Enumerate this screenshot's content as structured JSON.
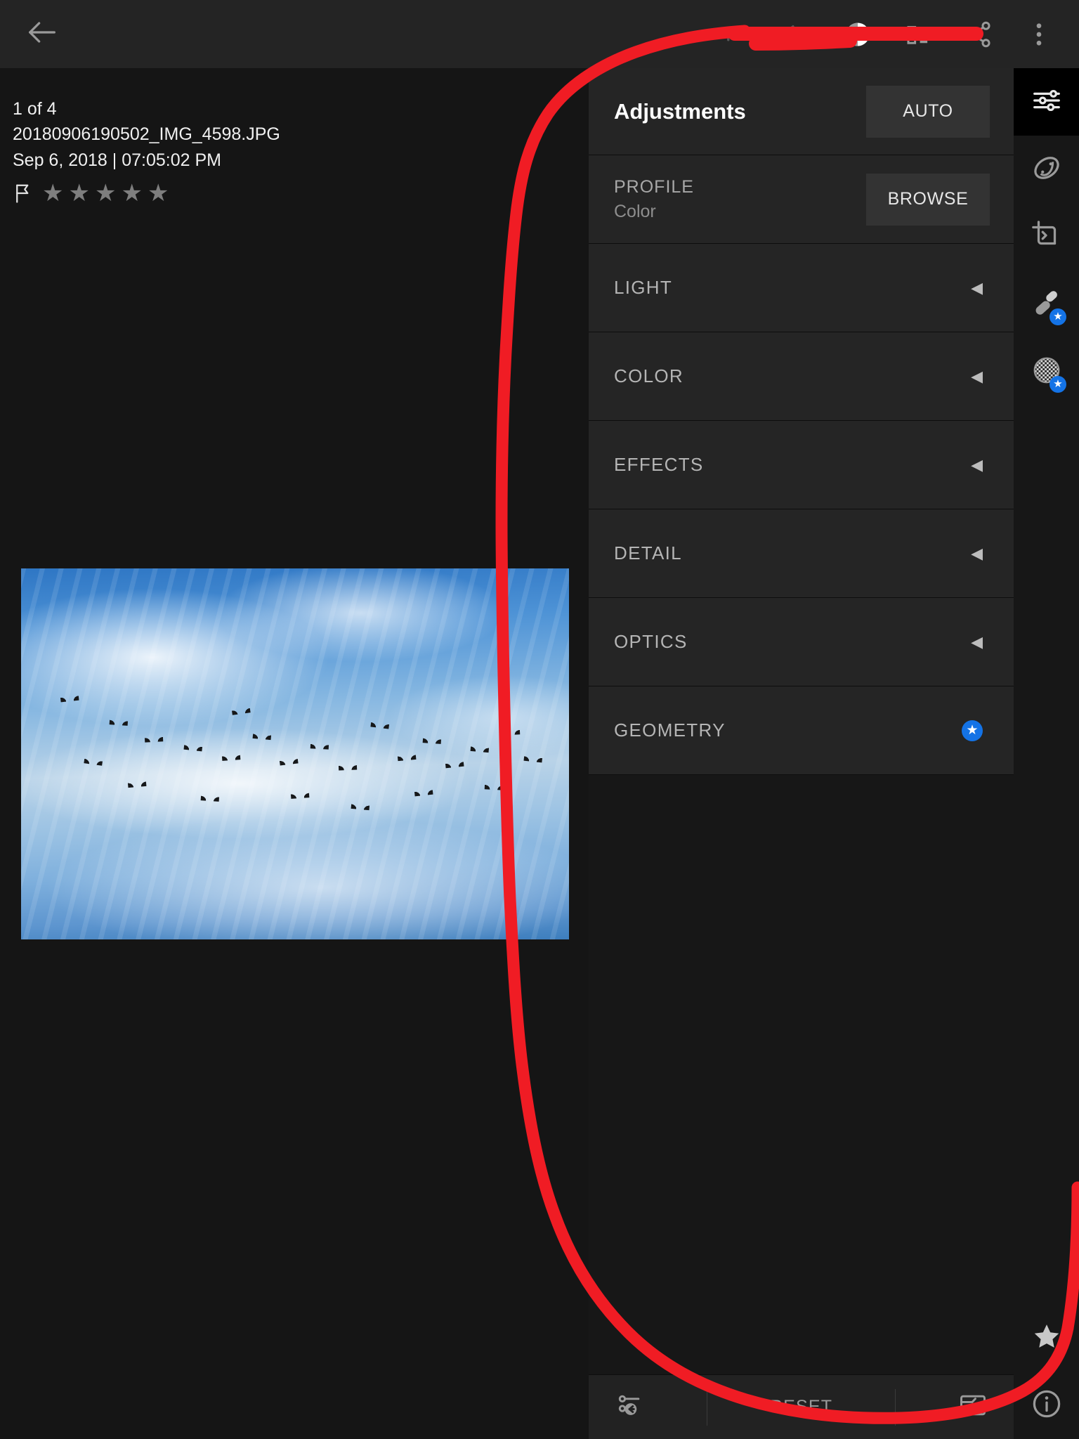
{
  "app": {
    "screen_title": "Adjustments",
    "accent_blue": "#1473e6",
    "annotation_color": "#f01c24",
    "panel_bg": "#252525",
    "app_bg": "#151515"
  },
  "topbar": {
    "back_icon": "arrow-left-icon",
    "redo_icon": "redo-icon",
    "undo_icon": "undo-icon",
    "selective_icon": "selective-edit-icon",
    "histogram_icon": "histogram-icon",
    "share_icon": "share-icon",
    "overflow_icon": "more-vertical-icon"
  },
  "photo_info": {
    "counter": "1 of 4",
    "filename": "20180906190502_IMG_4598.JPG",
    "datetime": "Sep 6, 2018 | 07:05:02 PM",
    "flag_icon": "flag-outline-icon",
    "rating": 0,
    "star_count": 5,
    "star_glyph": "★"
  },
  "panel": {
    "title": "Adjustments",
    "auto_label": "AUTO",
    "profile": {
      "label": "PROFILE",
      "value": "Color",
      "browse_label": "BROWSE"
    },
    "sections": [
      {
        "label": "LIGHT",
        "caret": "◀",
        "badge": false
      },
      {
        "label": "COLOR",
        "caret": "◀",
        "badge": false
      },
      {
        "label": "EFFECTS",
        "caret": "◀",
        "badge": false
      },
      {
        "label": "DETAIL",
        "caret": "◀",
        "badge": false
      },
      {
        "label": "OPTICS",
        "caret": "◀",
        "badge": false
      },
      {
        "label": "GEOMETRY",
        "caret": "",
        "badge": true,
        "badge_glyph": "★"
      }
    ],
    "bottom": {
      "previous_icon": "previous-edits-icon",
      "reset_label": "RESET",
      "versions_icon": "versions-icon"
    }
  },
  "rail": {
    "items": [
      {
        "name": "edit",
        "icon": "sliders-icon",
        "active": true,
        "badge": false
      },
      {
        "name": "healing",
        "icon": "healing-brush-icon",
        "active": false,
        "badge": false
      },
      {
        "name": "crop",
        "icon": "crop-rotate-icon",
        "active": false,
        "badge": false
      },
      {
        "name": "repair",
        "icon": "repair-brush-icon",
        "active": false,
        "badge": true,
        "badge_glyph": "★"
      },
      {
        "name": "masking",
        "icon": "masking-icon",
        "active": false,
        "badge": true,
        "badge_glyph": "★"
      }
    ],
    "bottom_items": [
      {
        "name": "premium",
        "icon": "star-icon",
        "badge": false
      },
      {
        "name": "info",
        "icon": "info-icon",
        "badge": false
      }
    ]
  },
  "annotation": {
    "type": "hand-drawn-circle",
    "description": "Red freehand ellipse highlighting the Adjustments panel and the undo control"
  }
}
